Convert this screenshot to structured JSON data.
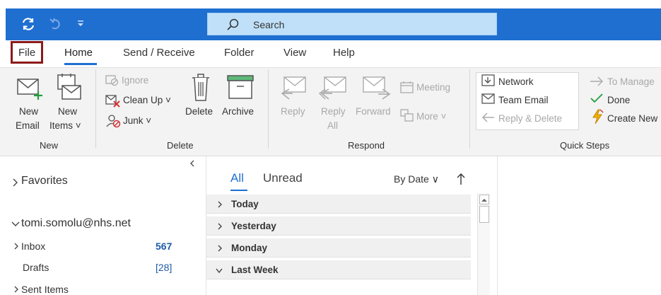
{
  "search": {
    "placeholder": "Search"
  },
  "tabs": [
    {
      "label": "File"
    },
    {
      "label": "Home"
    },
    {
      "label": "Send / Receive"
    },
    {
      "label": "Folder"
    },
    {
      "label": "View"
    },
    {
      "label": "Help"
    }
  ],
  "ribbon": {
    "new_group": {
      "label": "New",
      "new_email": [
        "New",
        "Email"
      ],
      "new_items": [
        "New",
        "Items ˅"
      ]
    },
    "delete_group": {
      "label": "Delete",
      "ignore": "Ignore",
      "clean_up": "Clean Up ˅",
      "junk": "Junk ˅",
      "delete": "Delete",
      "archive": "Archive"
    },
    "respond_group": {
      "label": "Respond",
      "reply": "Reply",
      "reply_all": [
        "Reply",
        "All"
      ],
      "forward": "Forward",
      "meeting": "Meeting",
      "more": "More ˅"
    },
    "quick_steps": {
      "label": "Quick Steps",
      "network": "Network",
      "team_email": "Team Email",
      "reply_delete": "Reply & Delete",
      "to_manager": "To Manage",
      "done": "Done",
      "create_new": "Create New"
    }
  },
  "folders": {
    "favorites": "Favorites",
    "account": "tomi.somolu@nhs.net",
    "inbox": {
      "label": "Inbox",
      "count": "567"
    },
    "drafts": {
      "label": "Drafts",
      "count": "[28]"
    },
    "sent": {
      "label": "Sent Items"
    }
  },
  "message_list": {
    "tab_all": "All",
    "tab_unread": "Unread",
    "sort": "By Date ∨",
    "groups": [
      "Today",
      "Yesterday",
      "Monday",
      "Last Week"
    ]
  },
  "colors": {
    "accent": "#1e6fd0",
    "unread_count": "#1e5aa8"
  }
}
